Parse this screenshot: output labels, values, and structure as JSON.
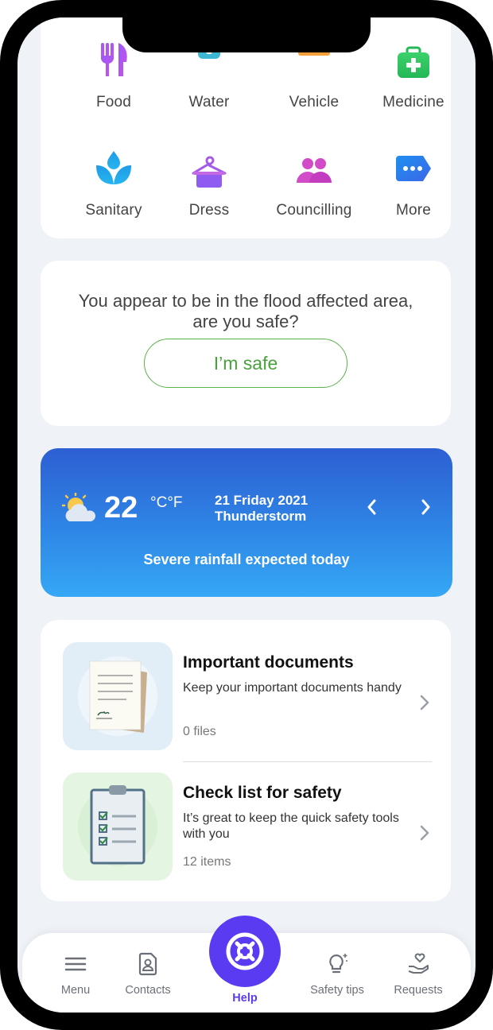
{
  "categories": [
    {
      "label": "Food",
      "icon": "fork-knife-icon"
    },
    {
      "label": "Water",
      "icon": "water-bottle-icon"
    },
    {
      "label": "Vehicle",
      "icon": "vehicle-icon"
    },
    {
      "label": "Medicine",
      "icon": "first-aid-icon"
    },
    {
      "label": "Sanitary",
      "icon": "lotus-drop-icon"
    },
    {
      "label": "Dress",
      "icon": "hanger-icon"
    },
    {
      "label": "Councilling",
      "icon": "people-icon"
    },
    {
      "label": "More",
      "icon": "more-tag-icon"
    }
  ],
  "safety_prompt": {
    "question_line1": "You appear to be in the flood affected area,",
    "question_line2": "are you safe?",
    "button_label": "I’m safe"
  },
  "weather": {
    "temperature": "22",
    "units": "°C°F",
    "date": "21 Friday 2021",
    "condition": "Thunderstorm",
    "message": "Severe rainfall expected today",
    "icon": "partly-cloudy-icon"
  },
  "documents": {
    "title": "Important documents",
    "description": "Keep your important documents handy",
    "count": "0 files"
  },
  "checklist": {
    "title": "Check list for safety",
    "description": "It’s great to keep the quick safety tools with you",
    "count": "12 items"
  },
  "nav": {
    "menu": "Menu",
    "contacts": "Contacts",
    "help": "Help",
    "safety_tips": "Safety tips",
    "requests": "Requests"
  },
  "colors": {
    "accent": "#5b3bf2",
    "safe_green": "#4aa03c",
    "background": "#eff3f8"
  }
}
